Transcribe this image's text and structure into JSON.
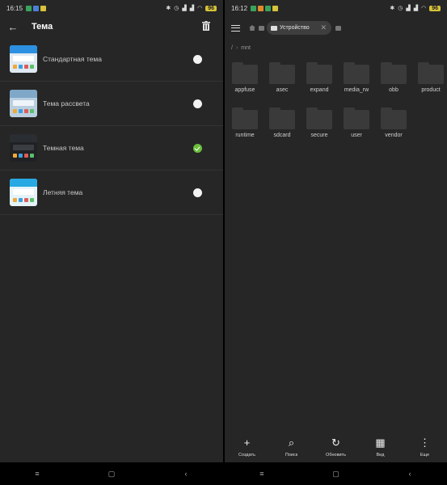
{
  "left": {
    "status": {
      "time": "16:15",
      "battery": "96"
    },
    "header": {
      "title": "Тема"
    },
    "themes": [
      {
        "label": "Стандартная тема",
        "selected": false,
        "thumb": {
          "bg": "#dfe9f2",
          "bar": "#2c8fe0",
          "card": "#ffffff"
        }
      },
      {
        "label": "Тема рассвета",
        "selected": false,
        "thumb": {
          "bg": "#b9cfe0",
          "bar": "#7fa7c7",
          "card": "#eef4f9"
        }
      },
      {
        "label": "Темная тема",
        "selected": true,
        "thumb": {
          "bg": "#1f2124",
          "bar": "#2a2d31",
          "card": "#3a3d41"
        }
      },
      {
        "label": "Летняя тема",
        "selected": false,
        "thumb": {
          "bg": "#e4f3f9",
          "bar": "#28a9e3",
          "card": "#ffffff"
        }
      }
    ]
  },
  "right": {
    "status": {
      "time": "16:12",
      "battery": "96"
    },
    "breadcrumb_chip": "Устройство",
    "path": {
      "root": "/",
      "current": "mnt"
    },
    "folders": [
      "appfuse",
      "asec",
      "expand",
      "media_rw",
      "obb",
      "product",
      "runtime",
      "sdcard",
      "secure",
      "user",
      "vendor"
    ],
    "actions": [
      {
        "icon": "plus-icon",
        "glyph": "+",
        "label": "Создать"
      },
      {
        "icon": "search-icon",
        "glyph": "⌕",
        "label": "Поиск"
      },
      {
        "icon": "refresh-icon",
        "glyph": "↻",
        "label": "Обновить"
      },
      {
        "icon": "grid-view-icon",
        "glyph": "▦",
        "label": "Вид"
      },
      {
        "icon": "more-icon",
        "glyph": "⋮",
        "label": "Еще"
      }
    ]
  },
  "nav": {
    "menu": "≡",
    "home": "▢",
    "back": "‹"
  },
  "colors": {
    "panel_bg": "#262626",
    "checked": "#6cbf3c",
    "folder": "#3a3a3a"
  }
}
